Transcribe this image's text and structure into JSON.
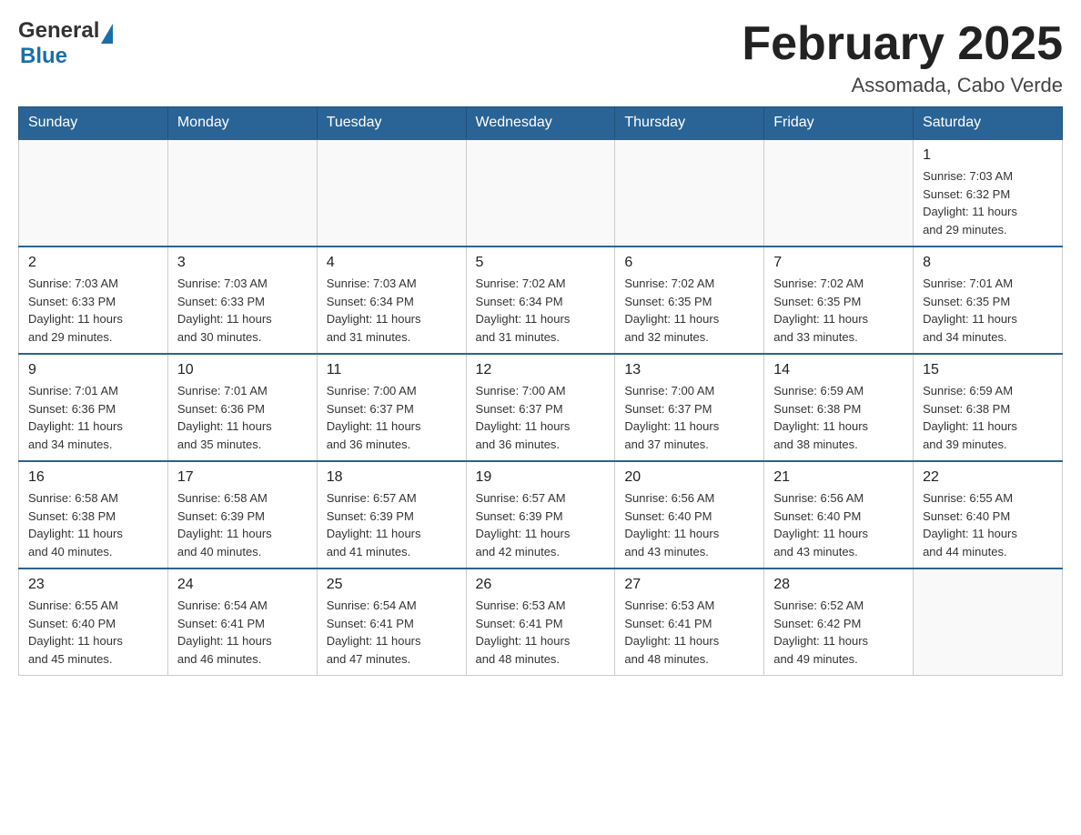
{
  "header": {
    "logo_general": "General",
    "logo_blue": "Blue",
    "title": "February 2025",
    "location": "Assomada, Cabo Verde"
  },
  "weekdays": [
    "Sunday",
    "Monday",
    "Tuesday",
    "Wednesday",
    "Thursday",
    "Friday",
    "Saturday"
  ],
  "weeks": [
    [
      {
        "day": "",
        "info": ""
      },
      {
        "day": "",
        "info": ""
      },
      {
        "day": "",
        "info": ""
      },
      {
        "day": "",
        "info": ""
      },
      {
        "day": "",
        "info": ""
      },
      {
        "day": "",
        "info": ""
      },
      {
        "day": "1",
        "info": "Sunrise: 7:03 AM\nSunset: 6:32 PM\nDaylight: 11 hours\nand 29 minutes."
      }
    ],
    [
      {
        "day": "2",
        "info": "Sunrise: 7:03 AM\nSunset: 6:33 PM\nDaylight: 11 hours\nand 29 minutes."
      },
      {
        "day": "3",
        "info": "Sunrise: 7:03 AM\nSunset: 6:33 PM\nDaylight: 11 hours\nand 30 minutes."
      },
      {
        "day": "4",
        "info": "Sunrise: 7:03 AM\nSunset: 6:34 PM\nDaylight: 11 hours\nand 31 minutes."
      },
      {
        "day": "5",
        "info": "Sunrise: 7:02 AM\nSunset: 6:34 PM\nDaylight: 11 hours\nand 31 minutes."
      },
      {
        "day": "6",
        "info": "Sunrise: 7:02 AM\nSunset: 6:35 PM\nDaylight: 11 hours\nand 32 minutes."
      },
      {
        "day": "7",
        "info": "Sunrise: 7:02 AM\nSunset: 6:35 PM\nDaylight: 11 hours\nand 33 minutes."
      },
      {
        "day": "8",
        "info": "Sunrise: 7:01 AM\nSunset: 6:35 PM\nDaylight: 11 hours\nand 34 minutes."
      }
    ],
    [
      {
        "day": "9",
        "info": "Sunrise: 7:01 AM\nSunset: 6:36 PM\nDaylight: 11 hours\nand 34 minutes."
      },
      {
        "day": "10",
        "info": "Sunrise: 7:01 AM\nSunset: 6:36 PM\nDaylight: 11 hours\nand 35 minutes."
      },
      {
        "day": "11",
        "info": "Sunrise: 7:00 AM\nSunset: 6:37 PM\nDaylight: 11 hours\nand 36 minutes."
      },
      {
        "day": "12",
        "info": "Sunrise: 7:00 AM\nSunset: 6:37 PM\nDaylight: 11 hours\nand 36 minutes."
      },
      {
        "day": "13",
        "info": "Sunrise: 7:00 AM\nSunset: 6:37 PM\nDaylight: 11 hours\nand 37 minutes."
      },
      {
        "day": "14",
        "info": "Sunrise: 6:59 AM\nSunset: 6:38 PM\nDaylight: 11 hours\nand 38 minutes."
      },
      {
        "day": "15",
        "info": "Sunrise: 6:59 AM\nSunset: 6:38 PM\nDaylight: 11 hours\nand 39 minutes."
      }
    ],
    [
      {
        "day": "16",
        "info": "Sunrise: 6:58 AM\nSunset: 6:38 PM\nDaylight: 11 hours\nand 40 minutes."
      },
      {
        "day": "17",
        "info": "Sunrise: 6:58 AM\nSunset: 6:39 PM\nDaylight: 11 hours\nand 40 minutes."
      },
      {
        "day": "18",
        "info": "Sunrise: 6:57 AM\nSunset: 6:39 PM\nDaylight: 11 hours\nand 41 minutes."
      },
      {
        "day": "19",
        "info": "Sunrise: 6:57 AM\nSunset: 6:39 PM\nDaylight: 11 hours\nand 42 minutes."
      },
      {
        "day": "20",
        "info": "Sunrise: 6:56 AM\nSunset: 6:40 PM\nDaylight: 11 hours\nand 43 minutes."
      },
      {
        "day": "21",
        "info": "Sunrise: 6:56 AM\nSunset: 6:40 PM\nDaylight: 11 hours\nand 43 minutes."
      },
      {
        "day": "22",
        "info": "Sunrise: 6:55 AM\nSunset: 6:40 PM\nDaylight: 11 hours\nand 44 minutes."
      }
    ],
    [
      {
        "day": "23",
        "info": "Sunrise: 6:55 AM\nSunset: 6:40 PM\nDaylight: 11 hours\nand 45 minutes."
      },
      {
        "day": "24",
        "info": "Sunrise: 6:54 AM\nSunset: 6:41 PM\nDaylight: 11 hours\nand 46 minutes."
      },
      {
        "day": "25",
        "info": "Sunrise: 6:54 AM\nSunset: 6:41 PM\nDaylight: 11 hours\nand 47 minutes."
      },
      {
        "day": "26",
        "info": "Sunrise: 6:53 AM\nSunset: 6:41 PM\nDaylight: 11 hours\nand 48 minutes."
      },
      {
        "day": "27",
        "info": "Sunrise: 6:53 AM\nSunset: 6:41 PM\nDaylight: 11 hours\nand 48 minutes."
      },
      {
        "day": "28",
        "info": "Sunrise: 6:52 AM\nSunset: 6:42 PM\nDaylight: 11 hours\nand 49 minutes."
      },
      {
        "day": "",
        "info": ""
      }
    ]
  ]
}
